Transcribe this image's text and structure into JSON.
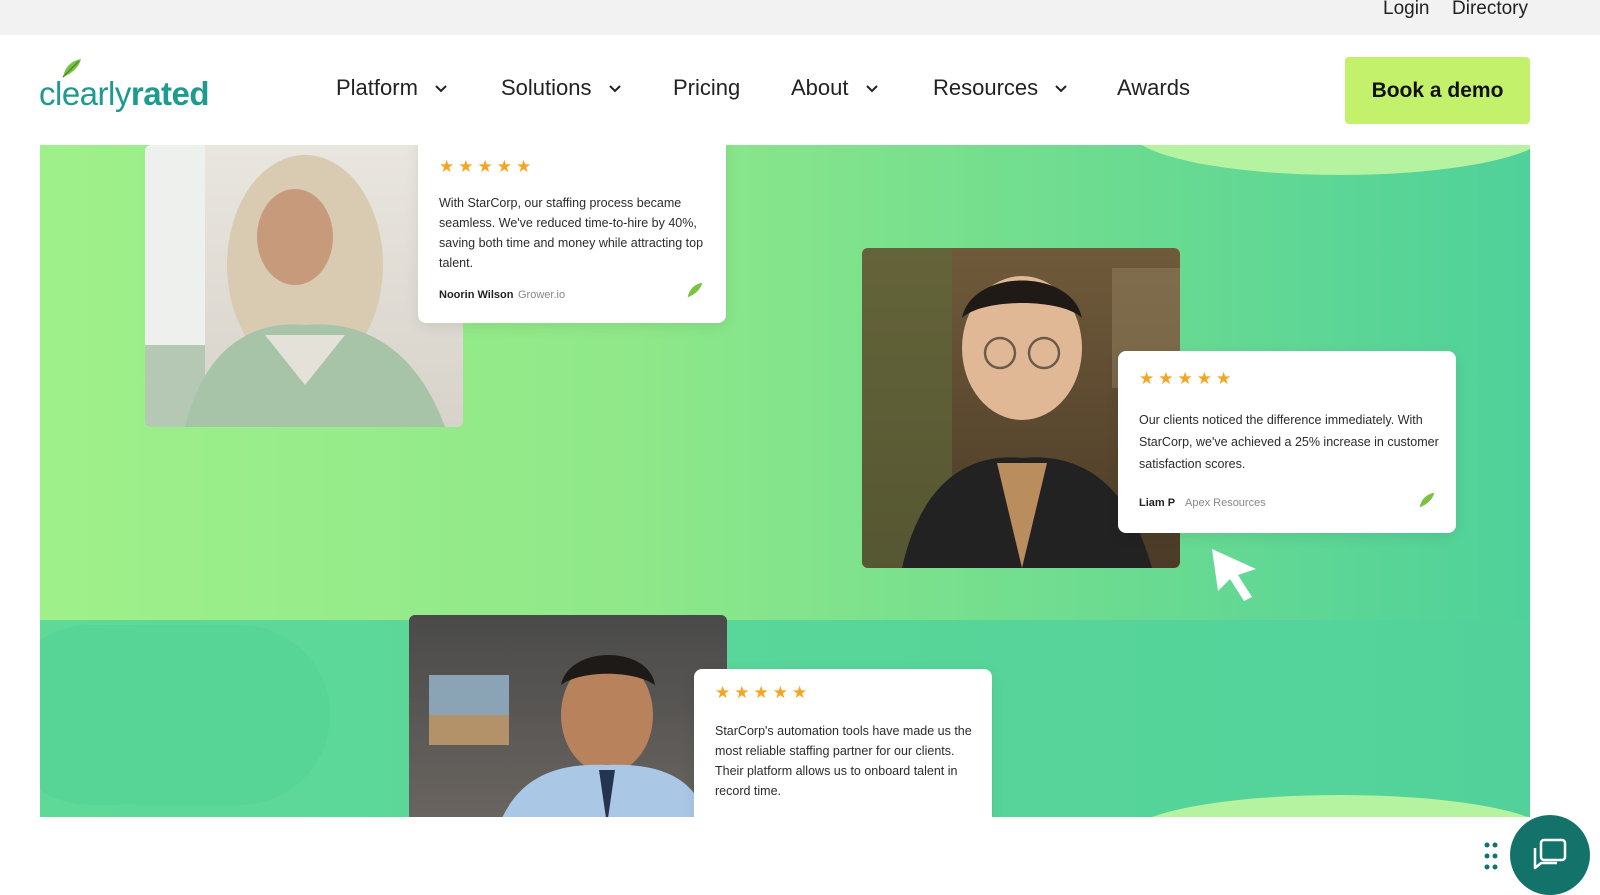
{
  "topbar": {
    "login": "Login",
    "directory": "Directory"
  },
  "brand": {
    "logo_light": "clearly",
    "logo_bold": "rated"
  },
  "nav": {
    "items": [
      {
        "label": "Platform",
        "dropdown": true
      },
      {
        "label": "Solutions",
        "dropdown": true
      },
      {
        "label": "Pricing",
        "dropdown": false
      },
      {
        "label": "About",
        "dropdown": true
      },
      {
        "label": "Resources",
        "dropdown": true
      },
      {
        "label": "Awards",
        "dropdown": false
      }
    ],
    "cta": "Book a demo"
  },
  "reviews": [
    {
      "stars": "★★★★★",
      "quote": "With StarCorp, our staffing process became seamless. We've reduced time-to-hire by 40%, saving both time and money while attracting top talent.",
      "author": "Noorin Wilson",
      "company": "Grower.io"
    },
    {
      "stars": "★★★★★",
      "quote": "Our clients noticed the difference immediately. With StarCorp, we've achieved a 25% increase in customer satisfaction scores.",
      "author": "Liam P",
      "company": "Apex Resources"
    },
    {
      "stars": "★★★★★",
      "quote": "StarCorp's automation tools have made us the most reliable staffing partner for our clients. Their platform allows us to onboard talent in record time.",
      "author": "",
      "company": ""
    }
  ],
  "colors": {
    "accent": "#c4f16b",
    "brand": "#1f9a8f",
    "star": "#f4a623",
    "chat": "#13736a"
  },
  "icons": {
    "chevron": "chevron-down-icon",
    "chat": "chat-icon",
    "cursor": "pointer-cursor-icon",
    "leaf": "leaf-icon"
  }
}
